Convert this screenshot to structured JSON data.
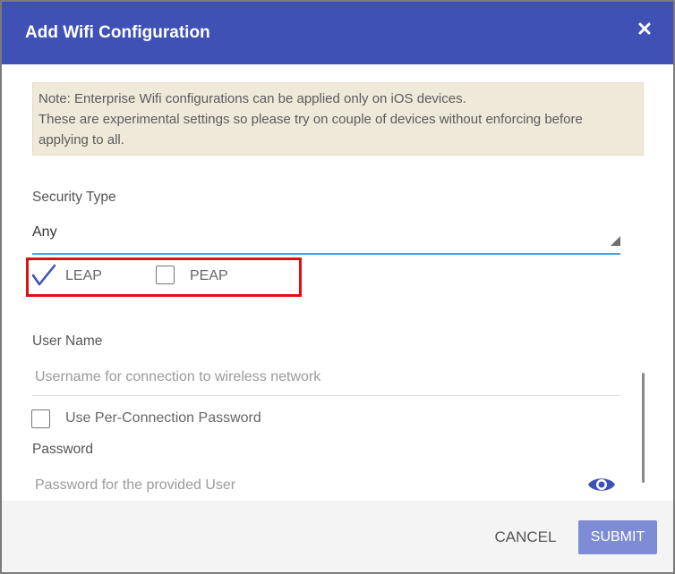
{
  "dialog": {
    "title": "Add Wifi Configuration"
  },
  "note": {
    "line1": "Note: Enterprise Wifi configurations can be applied only on iOS devices.",
    "line2": "These are experimental settings so please try on couple of devices without enforcing before",
    "line3": "applying to all."
  },
  "security_type": {
    "label": "Security Type",
    "value": "Any"
  },
  "eap_options": [
    {
      "label": "LEAP",
      "checked": true
    },
    {
      "label": "PEAP",
      "checked": false
    }
  ],
  "username": {
    "label": "User Name",
    "placeholder": "Username for connection to wireless network",
    "value": ""
  },
  "per_connection_password": {
    "label": "Use Per-Connection Password",
    "checked": false
  },
  "password": {
    "label": "Password",
    "placeholder": "Password for the provided User",
    "value": ""
  },
  "footer": {
    "cancel_label": "CANCEL",
    "submit_label": "SUBMIT"
  },
  "colors": {
    "header": "#3f51b5",
    "highlight_box": "#e01010",
    "select_underline": "#4aa3df",
    "submit_disabled": "#7d8cd4",
    "note_background": "#efe9da"
  }
}
